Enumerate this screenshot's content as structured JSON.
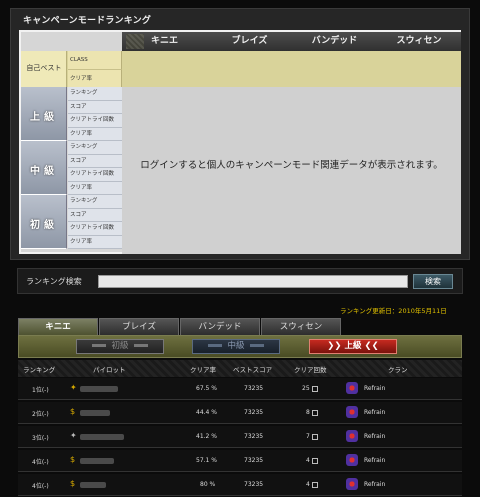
{
  "campaign_panel": {
    "title": "キャンペーンモードランキング",
    "characters": [
      "キニエ",
      "ブレイズ",
      "バンデッド",
      "スウィセン"
    ],
    "personal_best": {
      "label": "自己ベスト",
      "rows": [
        "CLASS",
        "クリア率"
      ]
    },
    "levels": [
      {
        "name": "上級",
        "rows": [
          "ランキング",
          "スコア",
          "クリアトライ回数",
          "クリア率"
        ]
      },
      {
        "name": "中級",
        "rows": [
          "ランキング",
          "スコア",
          "クリアトライ回数",
          "クリア率"
        ]
      },
      {
        "name": "初級",
        "rows": [
          "ランキング",
          "スコア",
          "クリアトライ回数",
          "クリア率"
        ]
      }
    ],
    "message": "ログインすると個人のキャンペーンモード関連データが表示されます。"
  },
  "search": {
    "label": "ランキング検索",
    "value": "",
    "button": "検索"
  },
  "updated": "ランキング更新日：2010年5月11日",
  "tabs": [
    "キニエ",
    "ブレイズ",
    "バンデッド",
    "スウィセン"
  ],
  "active_tab": "キニエ",
  "level_buttons": {
    "beginner": "初級",
    "intermediate": "中級",
    "advanced": "上級"
  },
  "ranking_table": {
    "headers": [
      "ランキング",
      "パイロット",
      "クリア率",
      "ベストスコア",
      "クリア回数",
      "クラン"
    ],
    "rows": [
      {
        "rank": "1位",
        "change": "(-)",
        "clear_rate": "67.5 %",
        "best_score": "73235",
        "clear_count": "25",
        "clan": "Refrain"
      },
      {
        "rank": "2位",
        "change": "(-)",
        "clear_rate": "44.4 %",
        "best_score": "73235",
        "clear_count": "8",
        "clan": "Refrain"
      },
      {
        "rank": "3位",
        "change": "(-)",
        "clear_rate": "41.2 %",
        "best_score": "73235",
        "clear_count": "7",
        "clan": "Refrain"
      },
      {
        "rank": "4位",
        "change": "(-)",
        "clear_rate": "57.1 %",
        "best_score": "73235",
        "clear_count": "4",
        "clan": "Refrain"
      },
      {
        "rank": "4位",
        "change": "(-)",
        "clear_rate": "80 %",
        "best_score": "73235",
        "clear_count": "4",
        "clan": "Refrain"
      }
    ]
  },
  "colors": {
    "accent_gold": "#e0c000",
    "tab_active": "#7c8064",
    "advanced_red": "#c62a20"
  }
}
